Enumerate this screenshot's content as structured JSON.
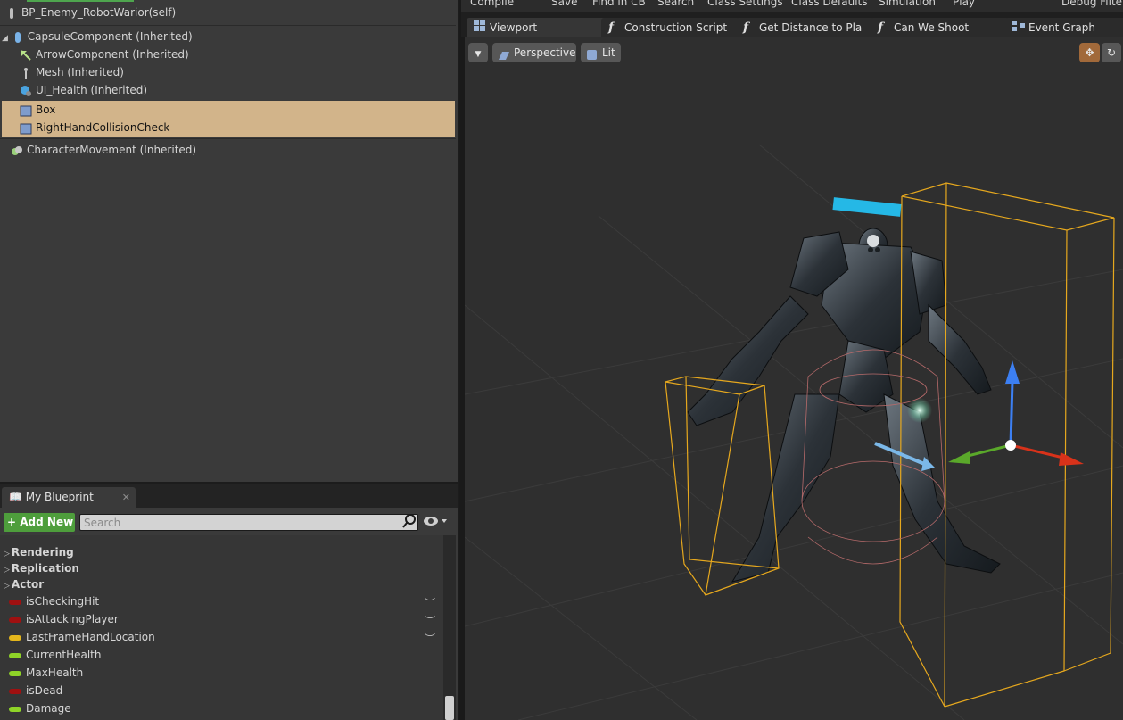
{
  "components": {
    "root": "BP_Enemy_RobotWarior(self)",
    "items": [
      {
        "label": "CapsuleComponent (Inherited)"
      },
      {
        "label": "ArrowComponent (Inherited)"
      },
      {
        "label": "Mesh (Inherited)"
      },
      {
        "label": "UI_Health (Inherited)"
      },
      {
        "label": "Box"
      },
      {
        "label": "RightHandCollisionCheck"
      },
      {
        "label": "CharacterMovement (Inherited)"
      }
    ]
  },
  "my_blueprint": {
    "tab_label": "My Blueprint",
    "add_new_label": "Add New",
    "search_placeholder": "Search",
    "categories": [
      "Rendering",
      "Replication",
      "Actor"
    ],
    "variables": [
      {
        "name": "isCheckingHit",
        "color": "#a01010"
      },
      {
        "name": "isAttackingPlayer",
        "color": "#a01010"
      },
      {
        "name": "LastFrameHandLocation",
        "color": "#e4b61c"
      },
      {
        "name": "CurrentHealth",
        "color": "#8fd428"
      },
      {
        "name": "MaxHealth",
        "color": "#8fd428"
      },
      {
        "name": "isDead",
        "color": "#a01010"
      },
      {
        "name": "Damage",
        "color": "#8fd428"
      }
    ]
  },
  "toolbar": {
    "items": [
      "Compile",
      "Save",
      "Find in CB",
      "Search",
      "Class Settings",
      "Class Defaults",
      "Simulation",
      "Play",
      "Debug Filter"
    ]
  },
  "editor_tabs": [
    {
      "label": "Viewport"
    },
    {
      "label": "Construction Script"
    },
    {
      "label": "Get Distance to Pla"
    },
    {
      "label": "Can We Shoot"
    },
    {
      "label": "Event Graph"
    }
  ],
  "viewport": {
    "perspective_label": "Perspective",
    "lit_label": "Lit"
  },
  "colors": {
    "selection": "#d2b48a",
    "add_new": "#4e9e3c",
    "bounds": "#e6a81e"
  }
}
